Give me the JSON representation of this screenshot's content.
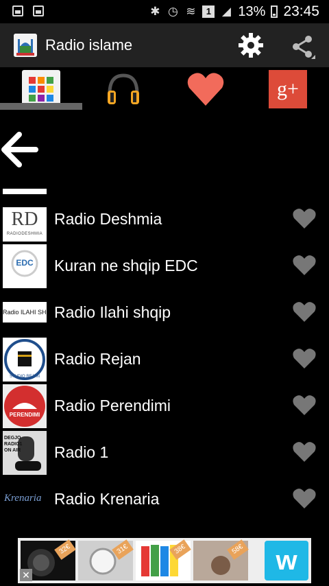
{
  "status_bar": {
    "icons_left": [
      "image-icon",
      "gallery-icon"
    ],
    "icons_right": [
      "bluetooth-icon",
      "alarm-icon",
      "wifi-icon",
      "sim-icon",
      "signal-icon"
    ],
    "sim_label": "1",
    "battery": "13%",
    "time": "23:45"
  },
  "app_bar": {
    "title": "Radio islame",
    "actions": [
      "settings-icon",
      "share-icon"
    ]
  },
  "tabs": [
    {
      "name": "grid",
      "icon": "grid-icon",
      "selected": true
    },
    {
      "name": "headphones",
      "icon": "headphones-icon",
      "selected": false
    },
    {
      "name": "favorites",
      "icon": "heart-icon",
      "selected": false
    },
    {
      "name": "google-plus",
      "icon": "google-plus-icon",
      "label": "g+",
      "selected": false
    }
  ],
  "back": {
    "icon": "back-arrow-icon"
  },
  "stations": [
    {
      "name": "Radio Deshmia",
      "logo": "RD",
      "logo_sub": "RADIODESHMIA"
    },
    {
      "name": "Kuran ne shqip EDC",
      "logo": "EDC"
    },
    {
      "name": "Radio Ilahi shqip",
      "logo": "Radio ILAHI SHQIP"
    },
    {
      "name": "Radio Rejan",
      "logo": "STUDIO REJAN"
    },
    {
      "name": "Radio Perendimi",
      "logo": "PERENDIMI"
    },
    {
      "name": "Radio 1",
      "logo": "DEGJO RADIO1 ON AIR"
    },
    {
      "name": "Radio Krenaria",
      "logo": "Krenaria"
    }
  ],
  "ad": {
    "badges": [
      "32€",
      "31€",
      "38€",
      "58€"
    ],
    "close": "✕",
    "brand": "w"
  },
  "colors": {
    "app_bar": "#222222",
    "heart_fav_tab": "#f26b5b",
    "google_plus": "#dd4b39",
    "heart_row": "#777777"
  }
}
